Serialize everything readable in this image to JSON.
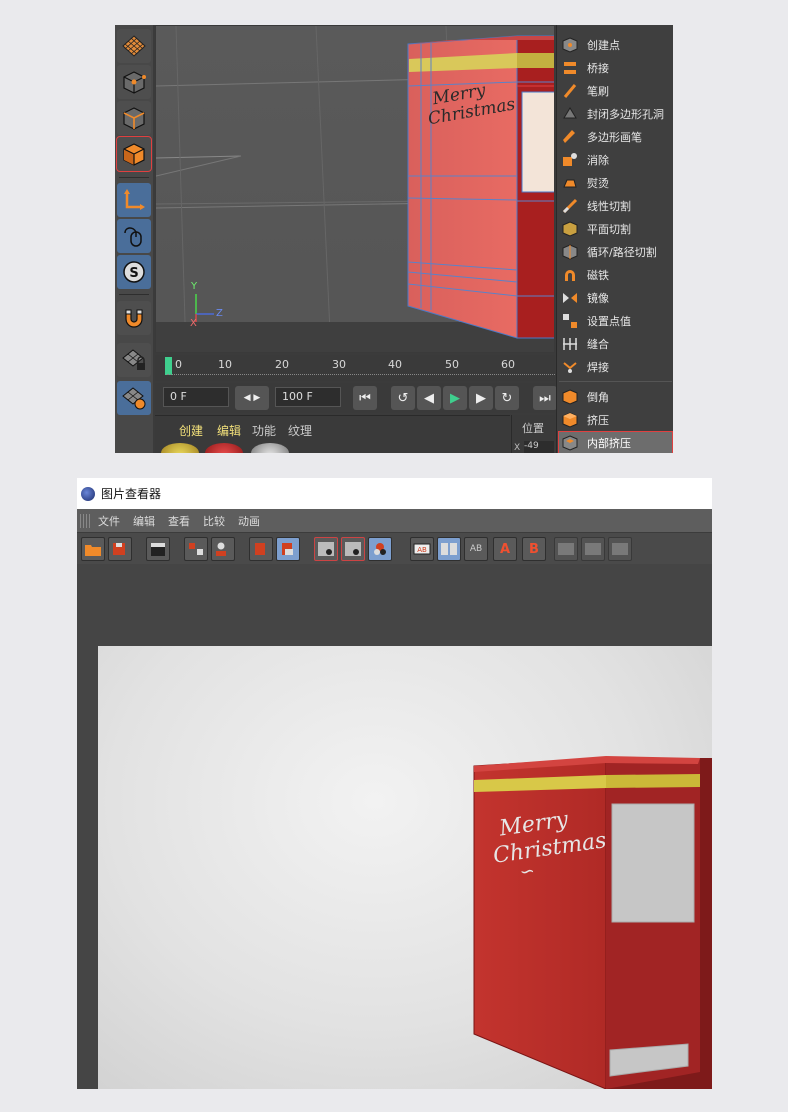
{
  "c4d": {
    "menu_items": [
      "创建点",
      "桥接",
      "笔刷",
      "封闭多边形孔洞",
      "多边形画笔",
      "消除",
      "熨烫",
      "线性切割",
      "平面切割",
      "循环/路径切割",
      "磁铁",
      "镜像",
      "设置点值",
      "缝合",
      "焊接",
      "倒角",
      "挤压",
      "内部挤压"
    ],
    "selected_menu_item": "内部挤压",
    "timeline_ticks": [
      "0",
      "10",
      "20",
      "30",
      "40",
      "50",
      "60"
    ],
    "frame_start": "0 F",
    "frame_end": "100 F",
    "material_tabs": [
      "创建",
      "编辑",
      "功能",
      "纹理"
    ],
    "panel_label": "位置",
    "axis_labels": {
      "x": "X",
      "y": "Y",
      "z": "Z"
    },
    "field_value": "-49"
  },
  "viewer": {
    "title": "图片查看器",
    "menus": [
      "文件",
      "编辑",
      "查看",
      "比较",
      "动画"
    ],
    "compare_a": "A",
    "compare_b": "B",
    "ab_label": "AB"
  },
  "box_text": {
    "line1": "Merry",
    "line2": "Christmas"
  },
  "colors": {
    "accent": "#e04040",
    "box_red": "#c9302c",
    "gold": "#d8c848",
    "toolbar_blue": "#4a6e9a"
  }
}
